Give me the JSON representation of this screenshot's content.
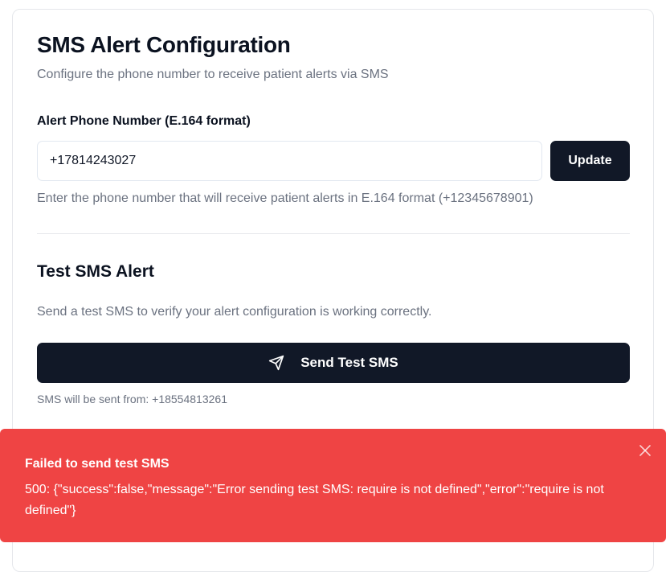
{
  "config": {
    "title": "SMS Alert Configuration",
    "subtitle": "Configure the phone number to receive patient alerts via SMS",
    "phone_label": "Alert Phone Number (E.164 format)",
    "phone_value": "+17814243027",
    "update_label": "Update",
    "hint": "Enter the phone number that will receive patient alerts in E.164 format (+12345678901)"
  },
  "test": {
    "title": "Test SMS Alert",
    "description": "Send a test SMS to verify your alert configuration is working correctly.",
    "button_label": "Send Test SMS",
    "button_icon": "send-icon",
    "from_note": "SMS will be sent from: +18554813261"
  },
  "toast": {
    "title": "Failed to send test SMS",
    "message": "500: {\"success\":false,\"message\":\"Error sending test SMS: require is not defined\",\"error\":\"require is not defined\"}",
    "close_icon": "close-icon",
    "color": "#ef4444"
  },
  "colors": {
    "primary_button": "#111827",
    "muted_text": "#6b7280",
    "border": "#e5e7eb"
  }
}
